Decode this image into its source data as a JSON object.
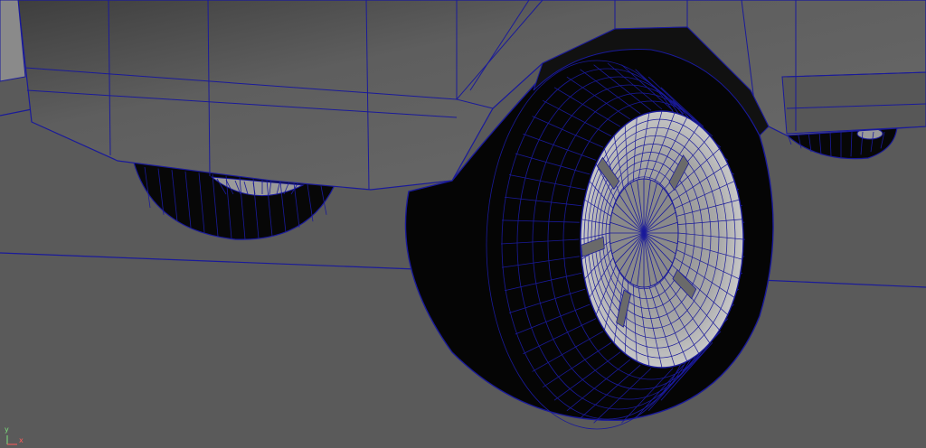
{
  "viewport": {
    "axis": {
      "y_label": "y",
      "x_label": "x"
    },
    "colors": {
      "background": "#5a5a5a",
      "body": "#5f5f5f",
      "body_dark": "#3c3c3c",
      "tire": "#050505",
      "rim": "#9a9a9a",
      "wire": "#1a1a9a",
      "axis_x": "#ff5a5a",
      "axis_y": "#7ee07e"
    }
  }
}
